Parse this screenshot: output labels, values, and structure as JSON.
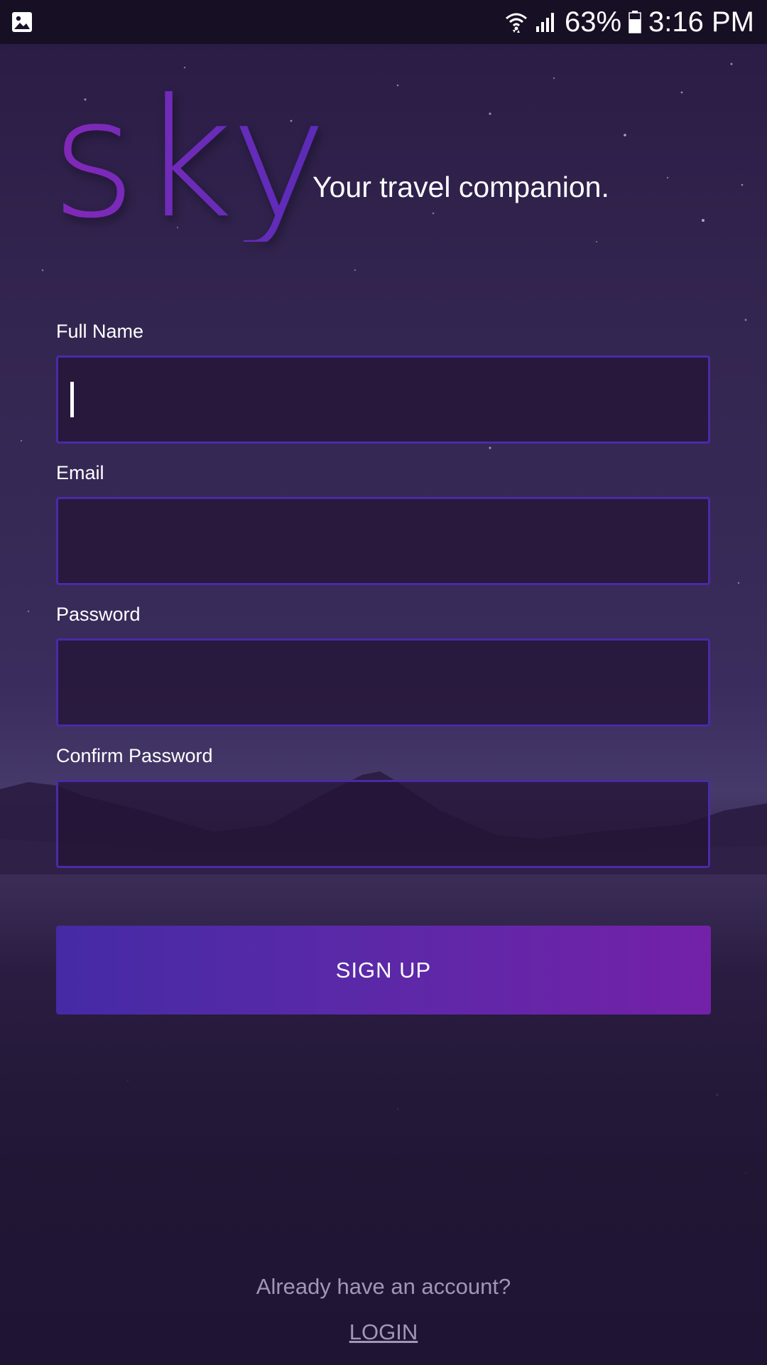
{
  "status_bar": {
    "battery_percent": "63%",
    "time": "3:16 PM",
    "icons": [
      "gallery-notification-icon",
      "wifi-icon",
      "signal-icon",
      "battery-icon"
    ]
  },
  "brand": {
    "logo": "sky",
    "tagline": "Your travel companion.",
    "logo_gradient": [
      "#8428b8",
      "#5a2bb8"
    ]
  },
  "form": {
    "full_name_label": "Full Name",
    "full_name_value": "",
    "email_label": "Email",
    "email_value": "",
    "password_label": "Password",
    "password_value": "",
    "confirm_password_label": "Confirm Password",
    "confirm_password_value": "",
    "field_border_color": "#4a2aa8"
  },
  "signup_button": {
    "label": "SIGN UP",
    "gradient": [
      "#452aa5",
      "#7321a8"
    ]
  },
  "footer": {
    "account_prompt": "Already have an account?",
    "login_label": "LOGIN"
  }
}
